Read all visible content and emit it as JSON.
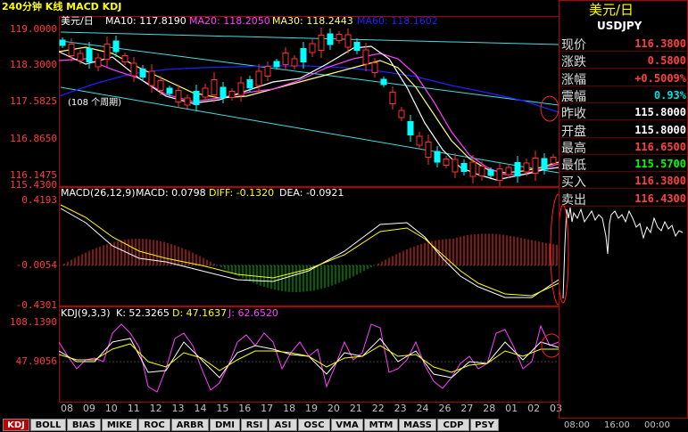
{
  "window": {
    "title_cn": "240分钟 K线 MACD KDJ"
  },
  "main_panel": {
    "symbol_label": "美元/日",
    "ma_labels": [
      {
        "text": "MA10: 117.8190",
        "color": "#ffffff"
      },
      {
        "text": "MA20: 118.2050",
        "color": "#ff40ff"
      },
      {
        "text": "MA30: 118.2443",
        "color": "#ffff80"
      },
      {
        "text": "MA60: 118.1602",
        "color": "#2020ff"
      }
    ],
    "y_ticks": [
      "119.0000",
      "118.3000",
      "117.5825",
      "116.8650",
      "116.1475",
      "115.4300"
    ],
    "annotation": "(108 个周期)"
  },
  "macd_panel": {
    "header": "MACD(26,12,9)",
    "values": [
      {
        "text": "MACD: 0.0798",
        "color": "#ffffff"
      },
      {
        "text": "DIFF: -0.1320",
        "color": "#ffff00"
      },
      {
        "text": "DEA: -0.0921",
        "color": "#ffffff"
      }
    ],
    "y_ticks": [
      "0.4193",
      "-0.0054",
      "-0.4301"
    ]
  },
  "kdj_panel": {
    "header": "KDJ(9,3,3)",
    "values": [
      {
        "text": "K: 52.3265",
        "color": "#ffffff"
      },
      {
        "text": "D: 47.1637",
        "color": "#ffff00"
      },
      {
        "text": "J: 62.6520",
        "color": "#ff40ff"
      }
    ],
    "y_ticks": [
      "108.1390",
      "47.9056"
    ]
  },
  "x_axis": [
    "08",
    "09",
    "10",
    "11",
    "12",
    "13",
    "14",
    "15",
    "16",
    "17",
    "18",
    "19",
    "20",
    "21",
    "22",
    "23",
    "24",
    "26",
    "27",
    "28",
    "01",
    "02",
    "03"
  ],
  "tabs": [
    "KDJ",
    "BOLL",
    "BIAS",
    "MIKE",
    "ROC",
    "ARBR",
    "DMI",
    "RSI",
    "ASI",
    "OSC",
    "VMA",
    "MTM",
    "MASS",
    "CDP",
    "PSY"
  ],
  "active_tab": "KDJ",
  "quote": {
    "title": "美元/日",
    "code": "USDJPY",
    "rows": [
      {
        "label": "现价",
        "value": "116.3800",
        "color": "#ff4040"
      },
      {
        "label": "涨跌",
        "value": "0.5800",
        "color": "#ff4040"
      },
      {
        "label": "涨幅",
        "value": "+0.5009%",
        "color": "#ff4040"
      },
      {
        "label": "震幅",
        "value": "0.93%",
        "color": "#00e0e0"
      },
      {
        "label": "昨收",
        "value": "115.8000",
        "color": "#ffffff"
      },
      {
        "label": "开盘",
        "value": "115.8000",
        "color": "#ffffff"
      },
      {
        "label": "最高",
        "value": "116.6500",
        "color": "#ff4040"
      },
      {
        "label": "最低",
        "value": "115.5700",
        "color": "#00ff00"
      },
      {
        "label": "买入",
        "value": "116.3800",
        "color": "#ff4040"
      },
      {
        "label": "卖出",
        "value": "116.4300",
        "color": "#ff4040"
      }
    ],
    "time_ticks": [
      "08:00",
      "16:00",
      "00:00"
    ]
  },
  "colors": {
    "frame": "#b00000",
    "up": "#ff3030",
    "down": "#00ffff",
    "accent": "#ffff00"
  }
}
